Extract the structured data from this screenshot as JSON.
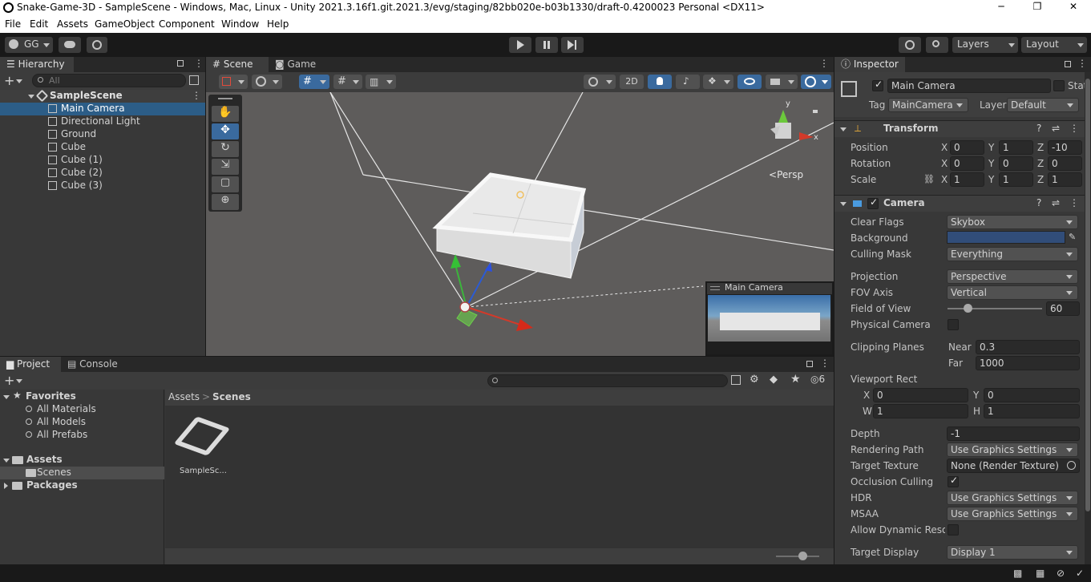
{
  "window": {
    "title": "Snake-Game-3D - SampleScene - Windows, Mac, Linux - Unity 2021.3.16f1.git.2021.3/evg/staging/82bb020e-b03b1330/draft-0.4200023 Personal <DX11>",
    "minimize": "─",
    "maximize": "❐",
    "close": "✕"
  },
  "menu": [
    "File",
    "Edit",
    "Assets",
    "GameObject",
    "Component",
    "Window",
    "Help"
  ],
  "toolbar": {
    "account": "GG",
    "layers": "Layers",
    "layout": "Layout"
  },
  "hierarchy": {
    "tab": "Hierarchy",
    "search_placeholder": "All",
    "scene": "SampleScene",
    "items": [
      "Main Camera",
      "Directional Light",
      "Ground",
      "Cube",
      "Cube (1)",
      "Cube (2)",
      "Cube (3)"
    ]
  },
  "sceneview": {
    "tabs": [
      "Scene",
      "Game"
    ],
    "mode_2d": "2D",
    "persp": "Persp",
    "gizmo_y": "y",
    "gizmo_x": "x",
    "preview_title": "Main Camera"
  },
  "project": {
    "tabs": [
      "Project",
      "Console"
    ],
    "favorites": "Favorites",
    "fav_items": [
      "All Materials",
      "All Models",
      "All Prefabs"
    ],
    "assets": "Assets",
    "scenes": "Scenes",
    "packages": "Packages",
    "breadcrumb_root": "Assets",
    "breadcrumb_sep": ">",
    "breadcrumb_current": "Scenes",
    "asset_name": "SampleSc...",
    "hidden_count": "6"
  },
  "inspector": {
    "tab": "Inspector",
    "object_name": "Main Camera",
    "static": "Static",
    "tag_label": "Tag",
    "tag": "MainCamera",
    "layer_label": "Layer",
    "layer": "Default",
    "transform": {
      "title": "Transform",
      "position": {
        "label": "Position",
        "x": "0",
        "y": "1",
        "z": "-10"
      },
      "rotation": {
        "label": "Rotation",
        "x": "0",
        "y": "0",
        "z": "0"
      },
      "scale": {
        "label": "Scale",
        "x": "1",
        "y": "1",
        "z": "1"
      }
    },
    "camera": {
      "title": "Camera",
      "clear_flags_label": "Clear Flags",
      "clear_flags": "Skybox",
      "background_label": "Background",
      "background_color": "#314d79",
      "culling_label": "Culling Mask",
      "culling": "Everything",
      "projection_label": "Projection",
      "projection": "Perspective",
      "fov_axis_label": "FOV Axis",
      "fov_axis": "Vertical",
      "fov_label": "Field of View",
      "fov": "60",
      "fov_fraction": 0.21,
      "physical_label": "Physical Camera",
      "clipping_label": "Clipping Planes",
      "near_label": "Near",
      "near": "0.3",
      "far_label": "Far",
      "far": "1000",
      "viewport_label": "Viewport Rect",
      "vx": "0",
      "vy": "0",
      "vw": "1",
      "vh": "1",
      "depth_label": "Depth",
      "depth": "-1",
      "rendering_label": "Rendering Path",
      "rendering": "Use Graphics Settings",
      "target_tex_label": "Target Texture",
      "target_tex": "None (Render Texture)",
      "occlusion_label": "Occlusion Culling",
      "hdr_label": "HDR",
      "hdr": "Use Graphics Settings",
      "msaa_label": "MSAA",
      "msaa": "Use Graphics Settings",
      "dynres_label": "Allow Dynamic Resol",
      "display_label": "Target Display",
      "display": "Display 1"
    },
    "axis_x": "X",
    "axis_y": "Y",
    "axis_z": "Z",
    "axis_w": "W",
    "axis_h": "H"
  }
}
